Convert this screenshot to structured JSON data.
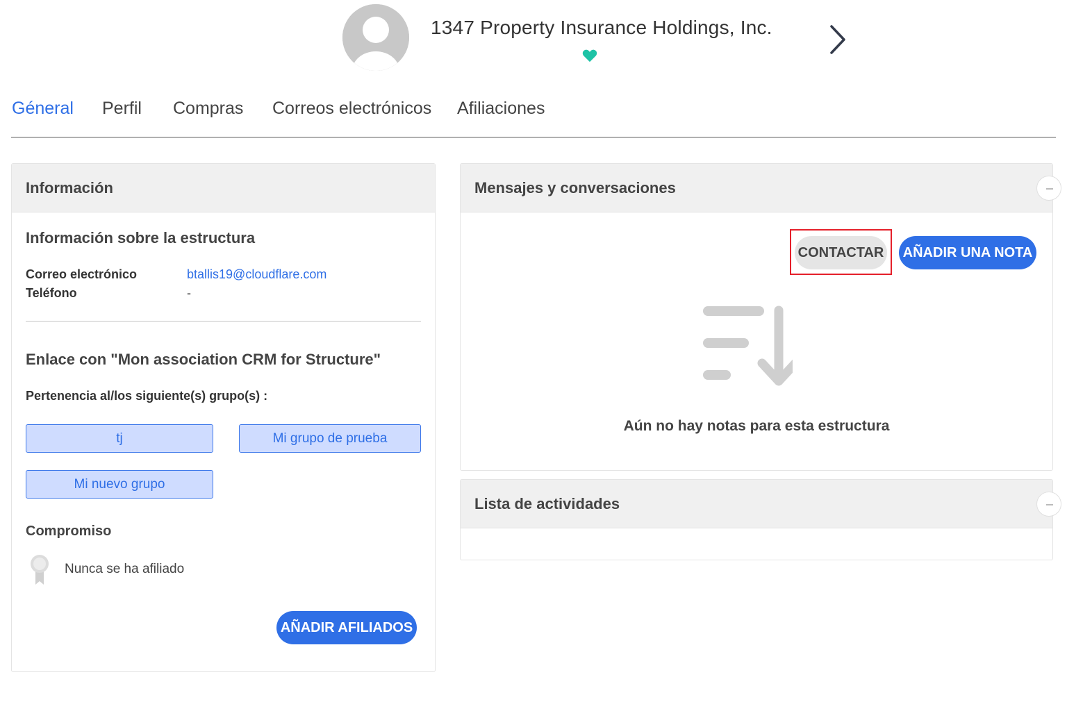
{
  "header": {
    "org_name": "1347 Property Insurance Holdings, Inc.",
    "icons": {
      "avatar": "user-avatar-placeholder",
      "favorite": "heart-icon",
      "next": "chevron-right-icon"
    },
    "colors": {
      "favorite": "#1ec3a6",
      "avatar_bg": "#c8c8c8"
    }
  },
  "tabs": [
    {
      "label": "Géneral",
      "active": true
    },
    {
      "label": "Perfil",
      "active": false
    },
    {
      "label": "Compras",
      "active": false
    },
    {
      "label": "Correos electrónicos",
      "active": false
    },
    {
      "label": "Afiliaciones",
      "active": false
    }
  ],
  "info_card": {
    "title": "Información",
    "structure_section": {
      "title": "Información sobre la estructura",
      "email_label": "Correo electrónico",
      "email_value": "btallis19@cloudflare.com",
      "phone_label": "Teléfono",
      "phone_value": "-"
    },
    "link_section": {
      "title": "Enlace con \"Mon association CRM for Structure\"",
      "groups_label": "Pertenencia al/los siguiente(s) grupo(s) :",
      "groups": [
        "tj",
        "Mi grupo de prueba",
        "Mi nuevo grupo"
      ]
    },
    "commitment": {
      "title": "Compromiso",
      "status": "Nunca se ha afiliado",
      "icon": "award-ribbon-icon"
    },
    "add_affiliates_label": "AÑADIR AFILIADOS"
  },
  "messages_card": {
    "title": "Mensajes y conversaciones",
    "contact_label": "CONTACTAR",
    "add_note_label": "AÑADIR UNA NOTA",
    "empty_icon": "sort-descending-icon",
    "empty_text": "Aún no hay notas para esta estructura"
  },
  "activities_card": {
    "title": "Lista de actividades"
  },
  "theme": {
    "accent": "#2f6fe6",
    "chip_bg": "#cfdcff",
    "highlight": "#e5202a"
  }
}
